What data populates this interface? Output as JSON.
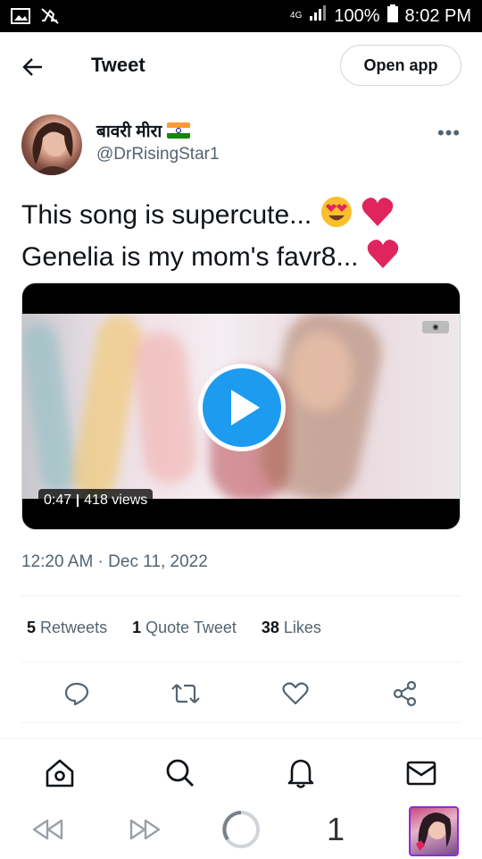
{
  "status_bar": {
    "network": "4G",
    "battery": "100%",
    "time": "8:02 PM"
  },
  "header": {
    "title": "Tweet",
    "open_app_label": "Open app"
  },
  "tweet": {
    "display_name": "बावरी मीरा",
    "handle": "@DrRisingStar1",
    "line1": "This song is supercute...",
    "line2": "Genelia is my mom's favr8...",
    "video": {
      "duration": "0:47",
      "views": "418 views"
    },
    "timestamp": "12:20 AM · Dec 11, 2022",
    "stats": {
      "retweets_count": "5",
      "retweets_label": "Retweets",
      "quotes_count": "1",
      "quotes_label": "Quote Tweet",
      "likes_count": "38",
      "likes_label": "Likes"
    }
  },
  "browser": {
    "tab_count": "1"
  },
  "colors": {
    "accent": "#1d9bf0",
    "text_primary": "#0f1419",
    "text_secondary": "#536471",
    "divider": "#eff3f4",
    "heart": "#e0245e"
  }
}
